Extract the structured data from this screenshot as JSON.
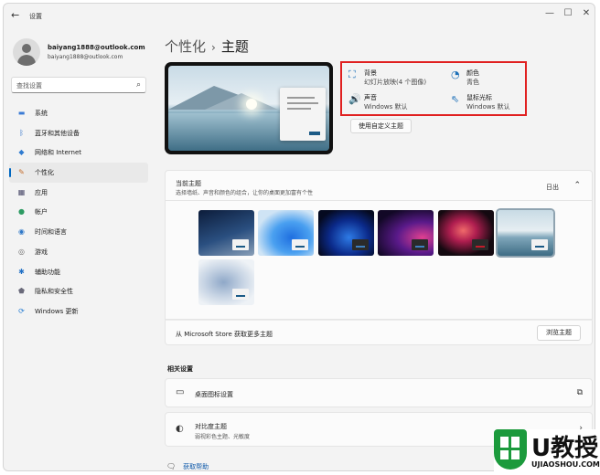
{
  "window": {
    "back_glyph": "←",
    "title": "设置",
    "controls": {
      "minimize": "—",
      "maximize": "☐",
      "close": "✕"
    }
  },
  "profile": {
    "name": "baiyang1888@outlook.com",
    "email": "baiyang1888@outlook.com"
  },
  "search": {
    "placeholder": "查找设置",
    "icon": "search-icon",
    "glyph": "⌕"
  },
  "sidebar": {
    "items": [
      {
        "label": "系统",
        "icon": "system-icon",
        "glyph": "▬",
        "color": "#3a7bd5"
      },
      {
        "label": "蓝牙和其他设备",
        "icon": "bluetooth-icon",
        "glyph": "ᛒ",
        "color": "#2a6fc9"
      },
      {
        "label": "网络和 Internet",
        "icon": "wifi-icon",
        "glyph": "◆",
        "color": "#2f7bd0"
      },
      {
        "label": "个性化",
        "icon": "brush-icon",
        "glyph": "✎",
        "color": "#c46d2c",
        "active": true
      },
      {
        "label": "应用",
        "icon": "apps-icon",
        "glyph": "▦",
        "color": "#4a4a6a"
      },
      {
        "label": "帐户",
        "icon": "account-icon",
        "glyph": "●",
        "color": "#2d9b63"
      },
      {
        "label": "时间和语言",
        "icon": "clock-globe-icon",
        "glyph": "◉",
        "color": "#2f78c8"
      },
      {
        "label": "游戏",
        "icon": "gamepad-icon",
        "glyph": "◎",
        "color": "#6b6b6b"
      },
      {
        "label": "辅助功能",
        "icon": "accessibility-icon",
        "glyph": "✱",
        "color": "#1f6fc5"
      },
      {
        "label": "隐私和安全性",
        "icon": "shield-icon",
        "glyph": "⬟",
        "color": "#6a6a7a"
      },
      {
        "label": "Windows 更新",
        "icon": "update-icon",
        "glyph": "⟳",
        "color": "#1f78d1"
      }
    ]
  },
  "breadcrumb": {
    "parent": "个性化",
    "separator": "›",
    "current": "主题"
  },
  "current_theme": {
    "background": {
      "title": "背景",
      "value": "幻灯片放映(4 个图像)",
      "icon": "image-icon",
      "glyph": "⛶"
    },
    "color": {
      "title": "颜色",
      "value": "青色",
      "icon": "palette-icon",
      "glyph": "◔"
    },
    "sound": {
      "title": "声音",
      "value": "Windows 默认",
      "icon": "speaker-icon",
      "glyph": "🔊"
    },
    "cursor": {
      "title": "鼠标光标",
      "value": "Windows 默认",
      "icon": "cursor-icon",
      "glyph": "⇖"
    },
    "customize_button": "使用自定义主题",
    "highlight_color": "#e02020"
  },
  "themes_section": {
    "title": "当前主题",
    "subtitle": "选择墙纸、声音和颜色的组合，让你的桌面更加富有个性",
    "collapse_label": "日出",
    "chevron": "⌃",
    "themes": [
      {
        "name": "theme-night-sky",
        "bg": "linear-gradient(160deg,#0c1c3a 0%,#2a4f80 55%,#8aa0b8 100%)",
        "btn": "light",
        "selected": false
      },
      {
        "name": "theme-windows-light",
        "bg": "radial-gradient(ellipse at 60% 60%,#1f6fe0 0%,#4aa0f0 40%,#cfe4f5 75%)",
        "btn": "light",
        "selected": false
      },
      {
        "name": "theme-windows-dark",
        "bg": "radial-gradient(ellipse at 55% 60%,#2e7be6 0%,#0b2a8a 45%,#050a20 80%)",
        "btn": "dark",
        "selected": false
      },
      {
        "name": "theme-glow",
        "bg": "radial-gradient(ellipse at 80% 60%,#e04090 0%,#5a1a8a 40%,#120826 80%)",
        "btn": "dark",
        "selected": false
      },
      {
        "name": "theme-captured-motion",
        "bg": "radial-gradient(ellipse at 45% 45%,#f06a6a 0%,#b01e50 30%,#140910 70%)",
        "btn": "red",
        "selected": false
      },
      {
        "name": "theme-sunrise-lake",
        "bg": "linear-gradient(180deg,#c8dbe5 0%,#e6eef2 45%,#7fa6ba 60%,#3e6c84 100%)",
        "btn": "light",
        "selected": true
      },
      {
        "name": "theme-flow",
        "bg": "radial-gradient(ellipse at 45% 50%,#8fa8c8 0%,#c7d4e4 45%,#eef2f6 80%)",
        "btn": "light",
        "selected": false
      }
    ],
    "store_text": "从 Microsoft Store 获取更多主题",
    "browse_button": "浏览主题"
  },
  "related": {
    "title": "相关设置",
    "items": [
      {
        "label": "桌面图标设置",
        "sub": "",
        "icon": "monitor-icon",
        "glyph": "▭",
        "arrow": "⧉",
        "arrow_icon": "external-link-icon"
      },
      {
        "label": "对比度主题",
        "sub": "弱视彩色主题、光敏度",
        "icon": "contrast-icon",
        "glyph": "◐",
        "arrow": "›",
        "arrow_icon": "chevron-right-icon"
      }
    ]
  },
  "help": {
    "label": "获取帮助",
    "glyph": "🗨",
    "icon": "help-icon"
  },
  "watermark": {
    "brand": "U教授",
    "url": "UJIAOSHOU.COM"
  }
}
